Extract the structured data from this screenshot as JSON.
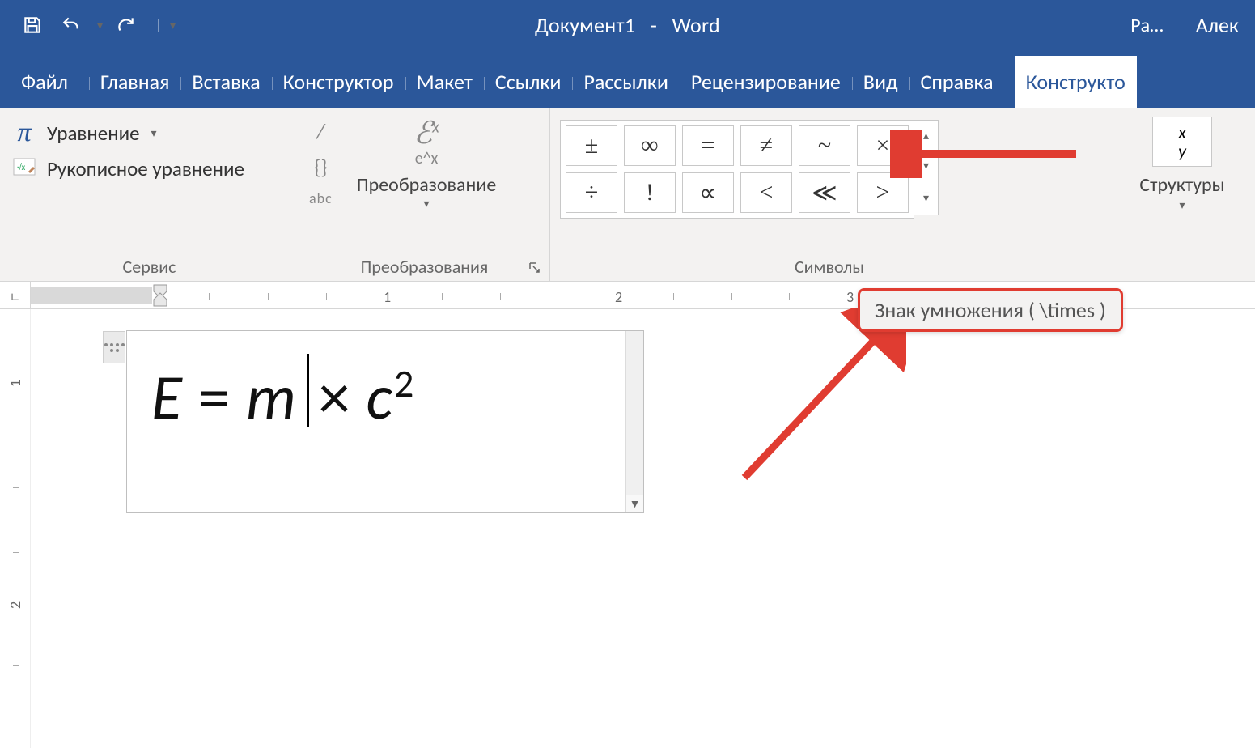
{
  "title": {
    "doc": "Документ1",
    "sep": "-",
    "app": "Word"
  },
  "account": {
    "pa": "Ра…",
    "name": "Алек"
  },
  "qat": {
    "save": "save",
    "undo": "undo",
    "redo": "redo"
  },
  "tabs": {
    "file": "Файл",
    "home": "Главная",
    "insert": "Вставка",
    "design": "Конструктор",
    "layout": "Макет",
    "references": "Ссылки",
    "mailings": "Рассылки",
    "review": "Рецензирование",
    "view": "Вид",
    "help": "Справка",
    "eqdesign": "Конструкто"
  },
  "ribbon": {
    "service": {
      "equation": "Уравнение",
      "ink": "Рукописное уравнение",
      "label": "Сервис"
    },
    "convert": {
      "big": "Преобразование",
      "abc": "abc",
      "label": "Преобразования"
    },
    "symbols": {
      "row1": [
        "±",
        "∞",
        "=",
        "≠",
        "~",
        "×"
      ],
      "row2": [
        "÷",
        "!",
        "∝",
        "<",
        "≪",
        ">"
      ],
      "label": "Символы"
    },
    "structures": {
      "label": "Структуры"
    }
  },
  "ruler": {
    "n1": "1",
    "n2": "2",
    "n3": "3"
  },
  "vruler": {
    "n1": "1",
    "n2": "2"
  },
  "equation": {
    "E": "E",
    "eq": "=",
    "m": "m",
    "times": "×",
    "c": "c",
    "sq": "2"
  },
  "tooltip": "Знак умножения ( \\times )"
}
